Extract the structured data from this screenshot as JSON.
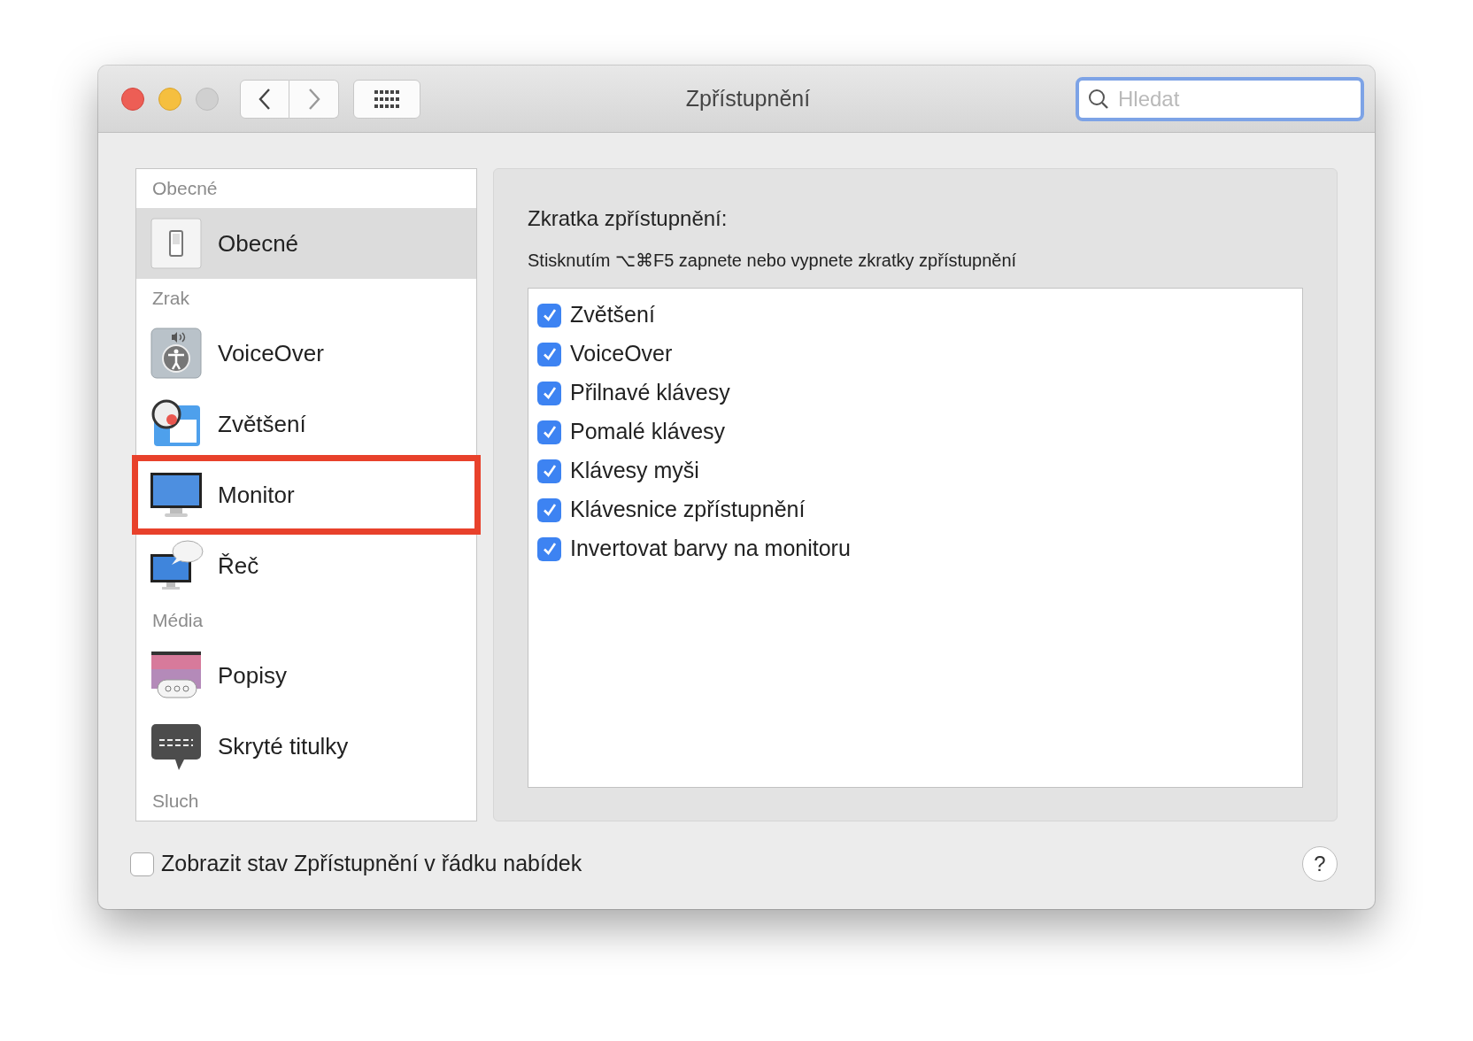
{
  "window": {
    "title": "Zpřístupnění"
  },
  "search": {
    "placeholder": "Hledat"
  },
  "sidebar": {
    "items": [
      {
        "kind": "header",
        "label": "Obecné"
      },
      {
        "kind": "item",
        "label": "Obecné",
        "selected": true,
        "outlined": false
      },
      {
        "kind": "header",
        "label": "Zrak"
      },
      {
        "kind": "item",
        "label": "VoiceOver",
        "selected": false,
        "outlined": false
      },
      {
        "kind": "item",
        "label": "Zvětšení",
        "selected": false,
        "outlined": false
      },
      {
        "kind": "item",
        "label": "Monitor",
        "selected": false,
        "outlined": true
      },
      {
        "kind": "item",
        "label": "Řeč",
        "selected": false,
        "outlined": false
      },
      {
        "kind": "header",
        "label": "Média"
      },
      {
        "kind": "item",
        "label": "Popisy",
        "selected": false,
        "outlined": false
      },
      {
        "kind": "item",
        "label": "Skryté titulky",
        "selected": false,
        "outlined": false
      },
      {
        "kind": "header",
        "label": "Sluch"
      }
    ]
  },
  "shortcut": {
    "title": "Zkratka zpřístupnění:",
    "description": "Stisknutím ⌥⌘F5 zapnete nebo vypnete zkratky zpřístupnění",
    "options": [
      {
        "label": "Zvětšení",
        "checked": true
      },
      {
        "label": "VoiceOver",
        "checked": true
      },
      {
        "label": "Přilnavé klávesy",
        "checked": true
      },
      {
        "label": "Pomalé klávesy",
        "checked": true
      },
      {
        "label": "Klávesy myši",
        "checked": true
      },
      {
        "label": "Klávesnice zpřístupnění",
        "checked": true
      },
      {
        "label": "Invertovat barvy na monitoru",
        "checked": true
      }
    ]
  },
  "footer": {
    "status_option": {
      "label": "Zobrazit stav Zpřístupnění v řádku nabídek",
      "checked": false
    },
    "help": "?"
  }
}
